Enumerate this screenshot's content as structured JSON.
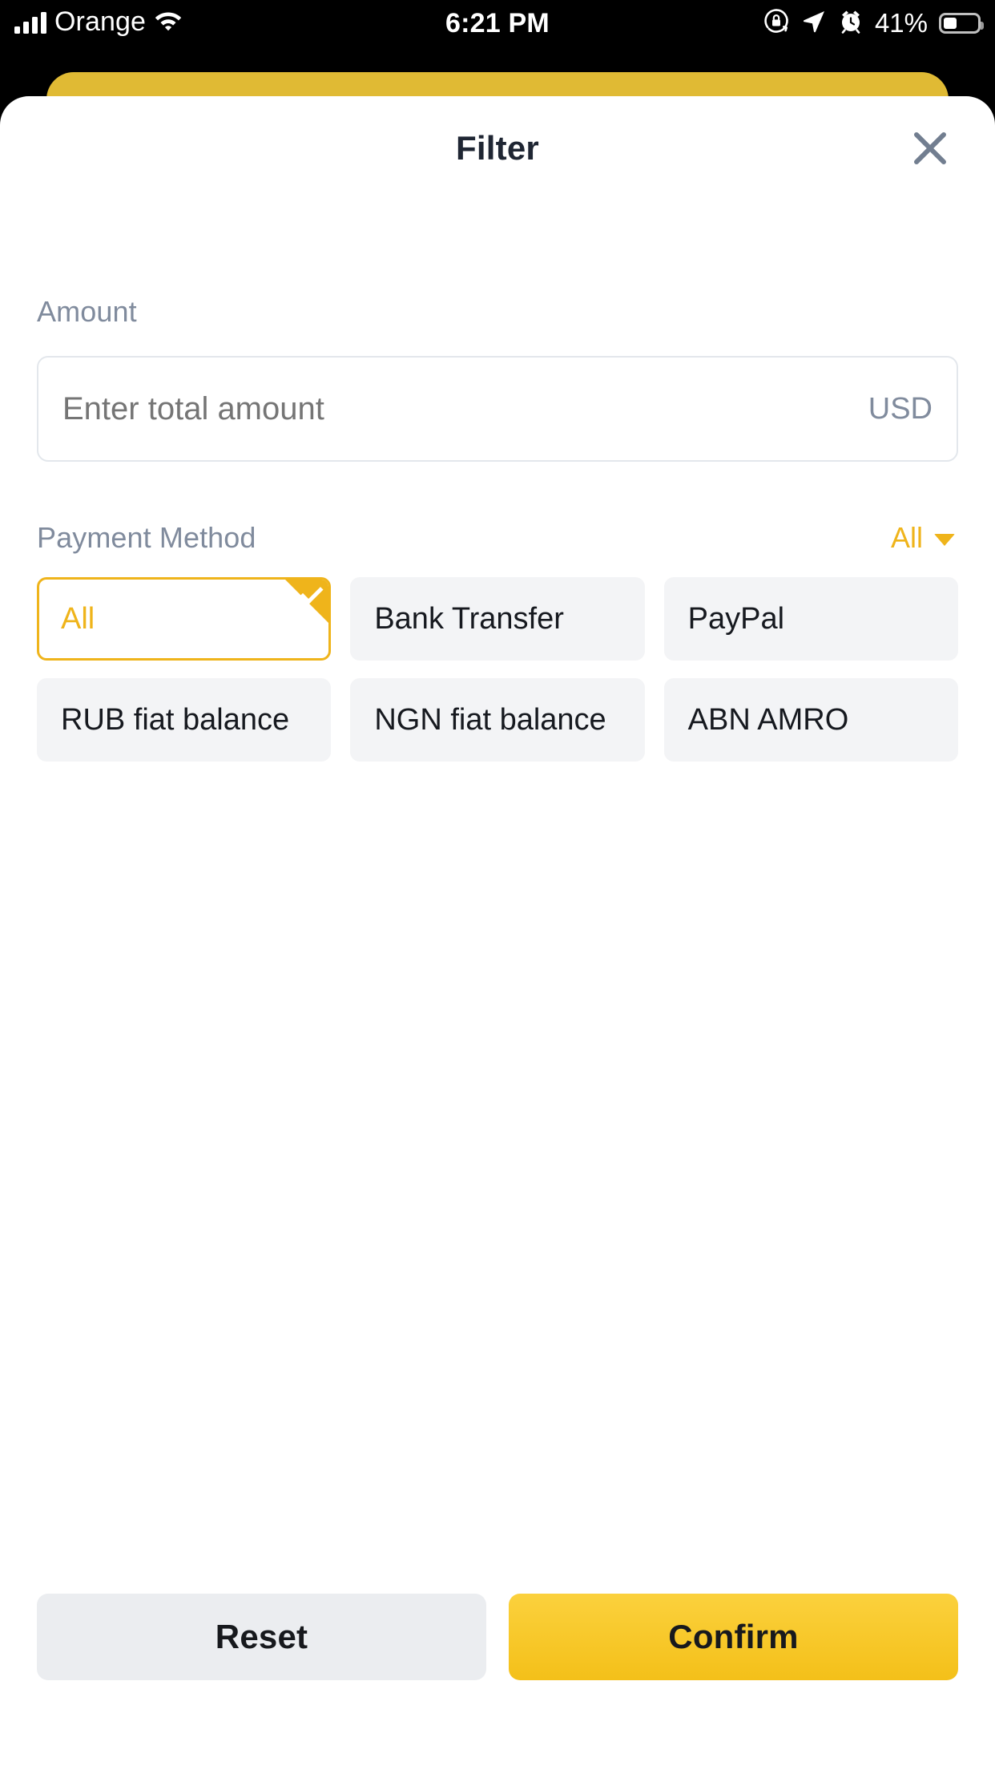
{
  "status_bar": {
    "carrier": "Orange",
    "time": "6:21 PM",
    "battery_percent": "41%",
    "icons": {
      "signal": "signal-bars-icon",
      "wifi": "wifi-icon",
      "rotation_lock": "rotation-lock-icon",
      "location": "location-arrow-icon",
      "alarm": "alarm-clock-icon",
      "battery": "battery-icon"
    }
  },
  "sheet": {
    "title": "Filter",
    "close_icon": "close-icon"
  },
  "amount": {
    "label": "Amount",
    "placeholder": "Enter total amount",
    "value": "",
    "currency": "USD"
  },
  "payment_method": {
    "label": "Payment Method",
    "dropdown_value": "All",
    "dropdown_icon": "chevron-down-icon",
    "options": [
      {
        "label": "All",
        "selected": true
      },
      {
        "label": "Bank Transfer",
        "selected": false
      },
      {
        "label": "PayPal",
        "selected": false
      },
      {
        "label": "RUB fiat balance",
        "selected": false
      },
      {
        "label": "NGN fiat balance",
        "selected": false
      },
      {
        "label": "ABN AMRO",
        "selected": false
      }
    ]
  },
  "footer": {
    "reset_label": "Reset",
    "confirm_label": "Confirm"
  },
  "colors": {
    "accent_yellow": "#EFB41B",
    "confirm_yellow": "#F7C81F",
    "behind_page_yellow": "#E0BA34",
    "chip_bg": "#F3F4F6",
    "label_gray": "#808B9D",
    "title_dark": "#1F2633"
  }
}
